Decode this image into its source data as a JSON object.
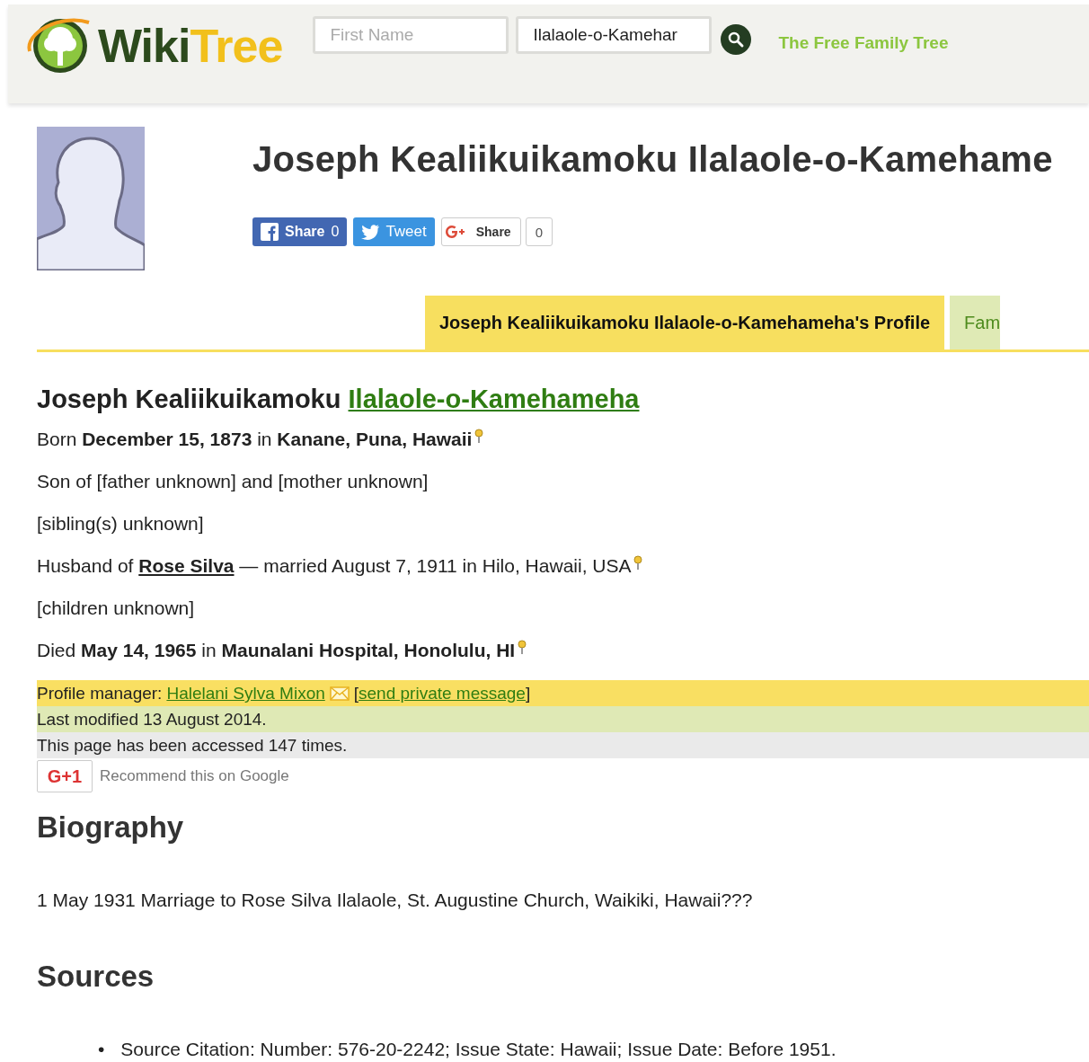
{
  "header": {
    "logo": {
      "first": "Wiki",
      "second": "Tree"
    },
    "search_fields": [
      {
        "placeholder": "First Name"
      },
      {
        "value": "Ilalaole-o-Kamehar"
      }
    ],
    "tagline": "The Free Family Tree"
  },
  "profile": {
    "title": "Joseph Kealiikuikamoku Ilalaole-o-Kamehame",
    "social_buttons": [
      {
        "kind": "facebook",
        "label": "Share",
        "count": "0"
      },
      {
        "kind": "twitter",
        "label": "Tweet"
      },
      {
        "kind": "google",
        "label": "Share",
        "count": "0"
      }
    ]
  },
  "tabs": [
    {
      "label": "Joseph Kealiikuikamoku Ilalaole-o-Kamehameha's Profile",
      "selected": true
    },
    {
      "label": "Fam",
      "selected": false
    }
  ],
  "person": {
    "first_names": "Joseph Kealiikuikamoku",
    "last_name": "Ilalaole-o-Kamehameha"
  },
  "facts": [
    {
      "kind": "text",
      "pin": true,
      "text": "Born **December 15, 1873** in **Kanane, Puna, Hawaii**"
    },
    {
      "kind": "text",
      "pin": false,
      "text": "Son of [father unknown] and [mother unknown]"
    },
    {
      "kind": "text",
      "pin": false,
      "text": "[sibling(s) unknown]"
    },
    {
      "kind": "spouse",
      "pin": true,
      "before": "Husband of",
      "spouse": "Rose Silva",
      "after": "— married August 7, 1911 in Hilo, Hawaii, USA"
    },
    {
      "kind": "text",
      "pin": false,
      "text": "[children unknown]"
    },
    {
      "kind": "text",
      "pin": true,
      "text": "Died **May 14, 1965** in **Maunalani Hospital, Honolulu, HI**"
    }
  ],
  "manager": {
    "label": "Profile manager:",
    "name": "Halelani Sylva Mixon",
    "open": "[",
    "message": "send private message",
    "close": "]"
  },
  "modified": "Last modified 13 August 2014.",
  "accessed": "This page has been accessed 147 times.",
  "plus_one": {
    "label": "G+1",
    "text": "Recommend this on Google"
  },
  "biography": {
    "heading": "Biography",
    "text": "1 May 1931 Marriage to Rose Silva Ilalaole, St. Augustine Church, Waikiki, Hawaii???"
  },
  "sources": {
    "heading": "Sources",
    "items": [
      {
        "bullet": "•",
        "text": "Source Citation: Number: 576-20-2242; Issue State: Hawaii; Issue Date: Before 1951."
      }
    ]
  }
}
